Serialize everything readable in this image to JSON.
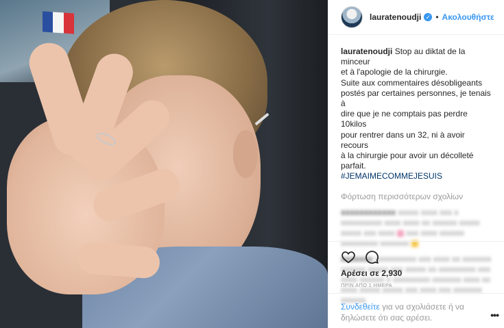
{
  "header": {
    "username": "lauratenoudji",
    "separator": "•",
    "follow_label": "Ακολουθήστε"
  },
  "caption": {
    "username": "lauratenoudji",
    "lines": [
      "Stop au diktat de la minceur",
      "et à l'apologie de la chirurgie.",
      "Suite aux commentaires désobligeants",
      "postés par certaines personnes, je tenais à",
      "dire que je ne comptais pas perdre 10kilos",
      "pour rentrer dans un 32, ni à avoir recours",
      "à la chirurgie pour avoir un décolleté parfait."
    ],
    "hashtag": "#JEMAIMECOMMEJESUIS"
  },
  "load_more": "Φόρτωση περισσότερων σχολίων",
  "likes": "Αρέσει σε 2,930",
  "time": "ΠΡΙΝ ΑΠΟ 1 ΗΜΕΡΑ",
  "login": {
    "link": "Συνδεθείτε",
    "text": "για να σχολιάσετε ή να δηλώσετε ότι σας αρέσει."
  },
  "more_label": "•••",
  "colors": {
    "accent": "#3897f0",
    "hashtag": "#003569",
    "muted": "#999999"
  },
  "icons": {
    "like": "heart-icon",
    "comment": "comment-icon",
    "verified": "verified-badge-icon"
  }
}
